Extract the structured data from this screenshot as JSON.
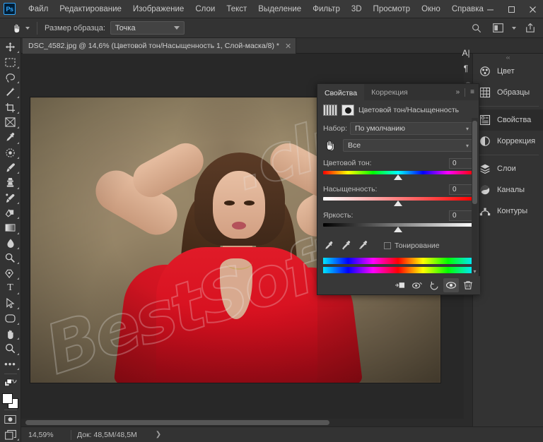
{
  "app": {
    "name": "Adobe Photoshop",
    "logo": "Ps"
  },
  "menubar": {
    "items": [
      "Файл",
      "Редактирование",
      "Изображение",
      "Слои",
      "Текст",
      "Выделение",
      "Фильтр",
      "3D",
      "Просмотр",
      "Окно",
      "Справка"
    ],
    "window_controls": {
      "minimize": "—",
      "maximize": "❐",
      "close": "✕"
    }
  },
  "optionsbar": {
    "tool_icon": "hand-tool-icon",
    "sample_size_label": "Размер образца:",
    "sample_size_value": "Точка",
    "right_icons": [
      "search-icon",
      "arrange-documents-icon",
      "share-icon"
    ]
  },
  "toolbar": {
    "tools": [
      {
        "name": "move-tool",
        "glyph": "✥"
      },
      {
        "name": "marquee-tool",
        "glyph": "▭"
      },
      {
        "name": "lasso-tool",
        "glyph": "✜"
      },
      {
        "name": "magic-wand-tool",
        "glyph": "✦"
      },
      {
        "name": "crop-tool",
        "glyph": "⌗"
      },
      {
        "name": "frame-tool",
        "glyph": "⊠"
      },
      {
        "name": "eyedropper-tool",
        "glyph": "✒"
      },
      {
        "name": "healing-brush-tool",
        "glyph": "◌"
      },
      {
        "name": "brush-tool",
        "glyph": "✎"
      },
      {
        "name": "clone-stamp-tool",
        "glyph": "⎙"
      },
      {
        "name": "history-brush-tool",
        "glyph": "✐"
      },
      {
        "name": "eraser-tool",
        "glyph": "◨"
      },
      {
        "name": "gradient-tool",
        "glyph": "▬"
      },
      {
        "name": "blur-tool",
        "glyph": "◍"
      },
      {
        "name": "dodge-tool",
        "glyph": "◐"
      },
      {
        "name": "pen-tool",
        "glyph": "✑"
      },
      {
        "name": "type-tool",
        "glyph": "T"
      },
      {
        "name": "path-selection-tool",
        "glyph": "➤"
      },
      {
        "name": "shape-tool",
        "glyph": "▢"
      },
      {
        "name": "hand-tool",
        "glyph": "✋"
      },
      {
        "name": "zoom-tool",
        "glyph": "⌕"
      },
      {
        "name": "edit-toolbar",
        "glyph": "⋯"
      }
    ],
    "default_colors_label": "default-colors",
    "swap_colors_label": "swap-colors",
    "quickmask_label": "quick-mask-mode",
    "screenmode_label": "screen-mode"
  },
  "document_tab": {
    "title": "DSC_4582.jpg @ 14,6% (Цветовой тон/Насыщенность 1, Слой-маска/8) *",
    "close": "✕"
  },
  "statusbar": {
    "zoom": "14,59%",
    "doc_info": "Док: 48,5M/48,5M",
    "arrow": "❯"
  },
  "right_dock": {
    "groups": [
      [
        {
          "label": "Цвет",
          "icon": "color-wheel-icon",
          "active": false
        },
        {
          "label": "Образцы",
          "icon": "swatches-grid-icon",
          "active": false
        }
      ],
      [
        {
          "label": "Свойства",
          "icon": "properties-icon",
          "active": true
        },
        {
          "label": "Коррекция",
          "icon": "adjustments-icon",
          "active": false
        }
      ],
      [
        {
          "label": "Слои",
          "icon": "layers-icon",
          "active": false
        },
        {
          "label": "Каналы",
          "icon": "channels-icon",
          "active": false
        },
        {
          "label": "Контуры",
          "icon": "paths-icon",
          "active": false
        }
      ]
    ]
  },
  "float_icons": [
    {
      "name": "character-panel-icon",
      "glyph": "A|"
    },
    {
      "name": "paragraph-panel-icon",
      "glyph": "¶"
    }
  ],
  "properties_panel": {
    "tabs": [
      {
        "label": "Свойства",
        "active": true
      },
      {
        "label": "Коррекция",
        "active": false
      }
    ],
    "collapse_icon": "»",
    "menu_icon": "≡",
    "adjustment_title": "Цветовой тон/Насыщенность",
    "preset_label": "Набор:",
    "preset_value": "По умолчанию",
    "channel_value": "Все",
    "sliders": [
      {
        "label": "Цветовой тон:",
        "value": "0",
        "bar": "hue",
        "thumb_pct": 50
      },
      {
        "label": "Насыщенность:",
        "value": "0",
        "bar": "saturation",
        "thumb_pct": 50
      },
      {
        "label": "Яркость:",
        "value": "0",
        "bar": "lightness",
        "thumb_pct": 50
      }
    ],
    "eyedroppers": [
      "eyedropper-icon",
      "eyedropper-add-icon",
      "eyedropper-subtract-icon"
    ],
    "colorize_label": "Тонирование",
    "colorize_checked": false,
    "footer_buttons": [
      {
        "name": "clip-to-layer-button",
        "glyph": "⇱",
        "active": false
      },
      {
        "name": "view-previous-state-button",
        "glyph": "👁",
        "active": false
      },
      {
        "name": "reset-button",
        "glyph": "↺",
        "active": false
      },
      {
        "name": "toggle-visibility-button",
        "glyph": "◉",
        "active": true
      },
      {
        "name": "delete-layer-button",
        "glyph": "🗑",
        "active": false
      }
    ]
  },
  "canvas": {
    "watermark_line1": "BestSoft",
    "watermark_line2": ".club",
    "image_alt": "woman-in-red-top-photo"
  },
  "colors": {
    "accent": "#31a8ff",
    "panel_bg": "#383838",
    "chrome_bg": "#333333",
    "canvas_bg": "#282828",
    "garment_red": "#d6101f",
    "backdrop_tan": "#9b8a6b"
  }
}
